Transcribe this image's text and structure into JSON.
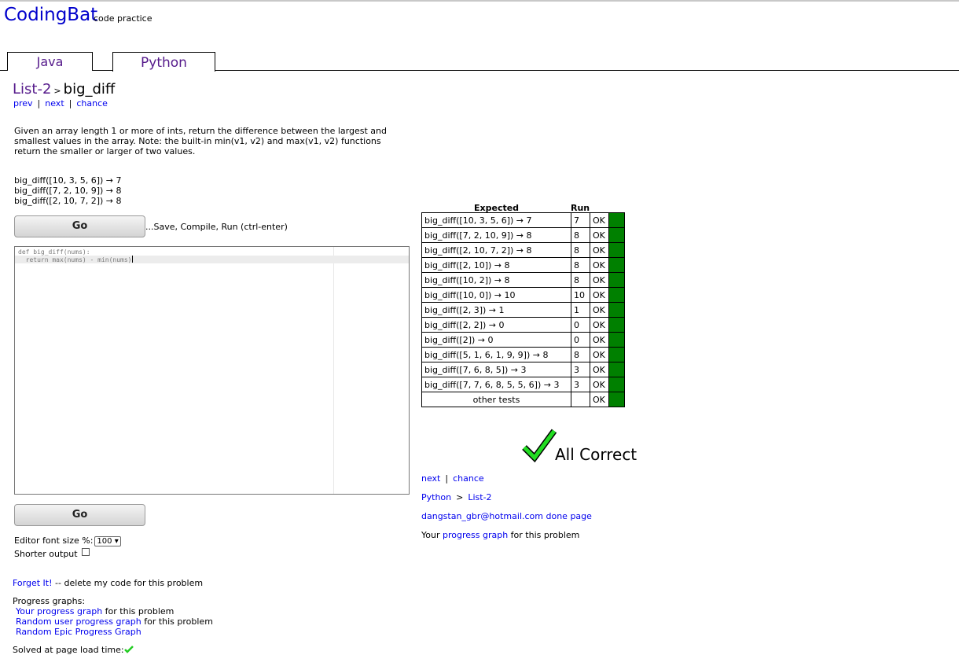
{
  "site": {
    "name": "CodingBat",
    "tagline": "code practice"
  },
  "tabs": [
    {
      "label": "Java"
    },
    {
      "label": "Python"
    }
  ],
  "breadcrumb": {
    "category": "List-2",
    "separator": ">",
    "problem": "big_diff"
  },
  "nav": {
    "prev": "prev",
    "next": "next",
    "chance": "chance"
  },
  "description": "Given an array length 1 or more of ints, return the difference between the largest and smallest values in the array. Note: the built-in min(v1, v2) and max(v1, v2) functions return the smaller or larger of two values.",
  "examples": [
    "big_diff([10, 3, 5, 6]) → 7",
    "big_diff([7, 2, 10, 9]) → 8",
    "big_diff([2, 10, 7, 2]) → 8"
  ],
  "go_button": "Go",
  "save_hint": "...Save, Compile, Run (ctrl-enter)",
  "editor": {
    "line1": "def big_diff(nums):",
    "line2": "  return max(nums) - min(nums)"
  },
  "options": {
    "font_size_label": "Editor font size %:",
    "font_size_value": "100 ▾",
    "shorter_label": "Shorter output"
  },
  "forget": {
    "link": "Forget It!",
    "text": " -- delete my code for this problem"
  },
  "progress": {
    "heading": "Progress graphs:",
    "your_link": "Your progress graph",
    "your_suffix": " for this problem",
    "random_link": "Random user progress graph",
    "random_suffix": " for this problem",
    "epic_link": "Random Epic Progress Graph"
  },
  "solved": "Solved at page load time:",
  "results": {
    "header_expected": "Expected",
    "header_run": "Run",
    "rows": [
      {
        "expected": "big_diff([10, 3, 5, 6]) → 7",
        "run": "7",
        "status": "OK"
      },
      {
        "expected": "big_diff([7, 2, 10, 9]) → 8",
        "run": "8",
        "status": "OK"
      },
      {
        "expected": "big_diff([2, 10, 7, 2]) → 8",
        "run": "8",
        "status": "OK"
      },
      {
        "expected": "big_diff([2, 10]) → 8",
        "run": "8",
        "status": "OK"
      },
      {
        "expected": "big_diff([10, 2]) → 8",
        "run": "8",
        "status": "OK"
      },
      {
        "expected": "big_diff([10, 0]) → 10",
        "run": "10",
        "status": "OK"
      },
      {
        "expected": "big_diff([2, 3]) → 1",
        "run": "1",
        "status": "OK"
      },
      {
        "expected": "big_diff([2, 2]) → 0",
        "run": "0",
        "status": "OK"
      },
      {
        "expected": "big_diff([2]) → 0",
        "run": "0",
        "status": "OK"
      },
      {
        "expected": "big_diff([5, 1, 6, 1, 9, 9]) → 8",
        "run": "8",
        "status": "OK"
      },
      {
        "expected": "big_diff([7, 6, 8, 5]) → 3",
        "run": "3",
        "status": "OK"
      },
      {
        "expected": "big_diff([7, 7, 6, 8, 5, 5, 6]) → 3",
        "run": "3",
        "status": "OK"
      },
      {
        "expected": "other tests",
        "run": "",
        "status": "OK"
      }
    ],
    "all_correct": "All Correct"
  },
  "after": {
    "next": "next",
    "chance": "chance",
    "lang": "Python",
    "sep": ">",
    "cat": "List-2",
    "user": "dangstan_gbr@hotmail.com",
    "done_page": "done page",
    "progress_prefix": "Your ",
    "progress_link": "progress graph",
    "progress_suffix": " for this problem"
  },
  "colors": {
    "pass_green": "#008000",
    "check_green": "#22cc22",
    "link_blue": "#0000ee"
  },
  "icons": {
    "check": "check-icon"
  }
}
